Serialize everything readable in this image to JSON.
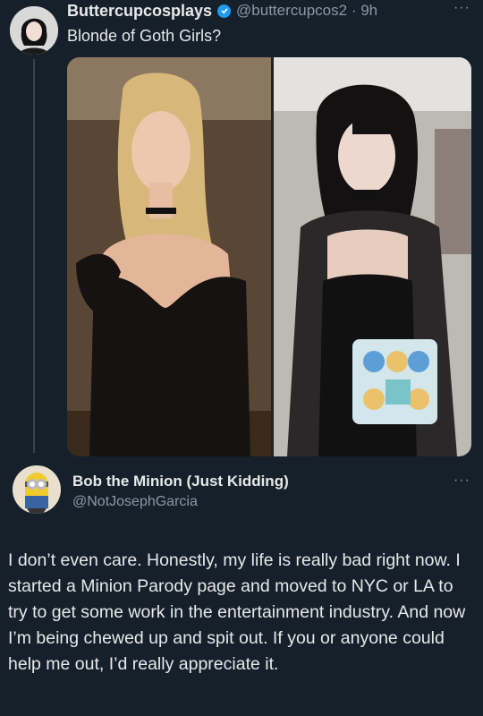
{
  "post1": {
    "display_name": "Buttercupcosplays",
    "handle_time": "@buttercupcos2 · 9h",
    "text": "Blonde of Goth Girls?",
    "more": "···"
  },
  "post2": {
    "display_name": "Bob the Minion (Just Kidding)",
    "handle": "@NotJosephGarcia",
    "more": "···",
    "body": "I don’t even care. Honestly, my life is really bad right now. I started a Minion Parody page and moved to NYC or LA to try to get some work in the entertainment industry. And now I’m being chewed up and spit out. If you or anyone could help me out, I’d really appreciate it."
  },
  "colors": {
    "background": "#15202b",
    "text": "#e7e9ea",
    "secondary": "#8b98a5",
    "verified": "#1d9bf0"
  }
}
